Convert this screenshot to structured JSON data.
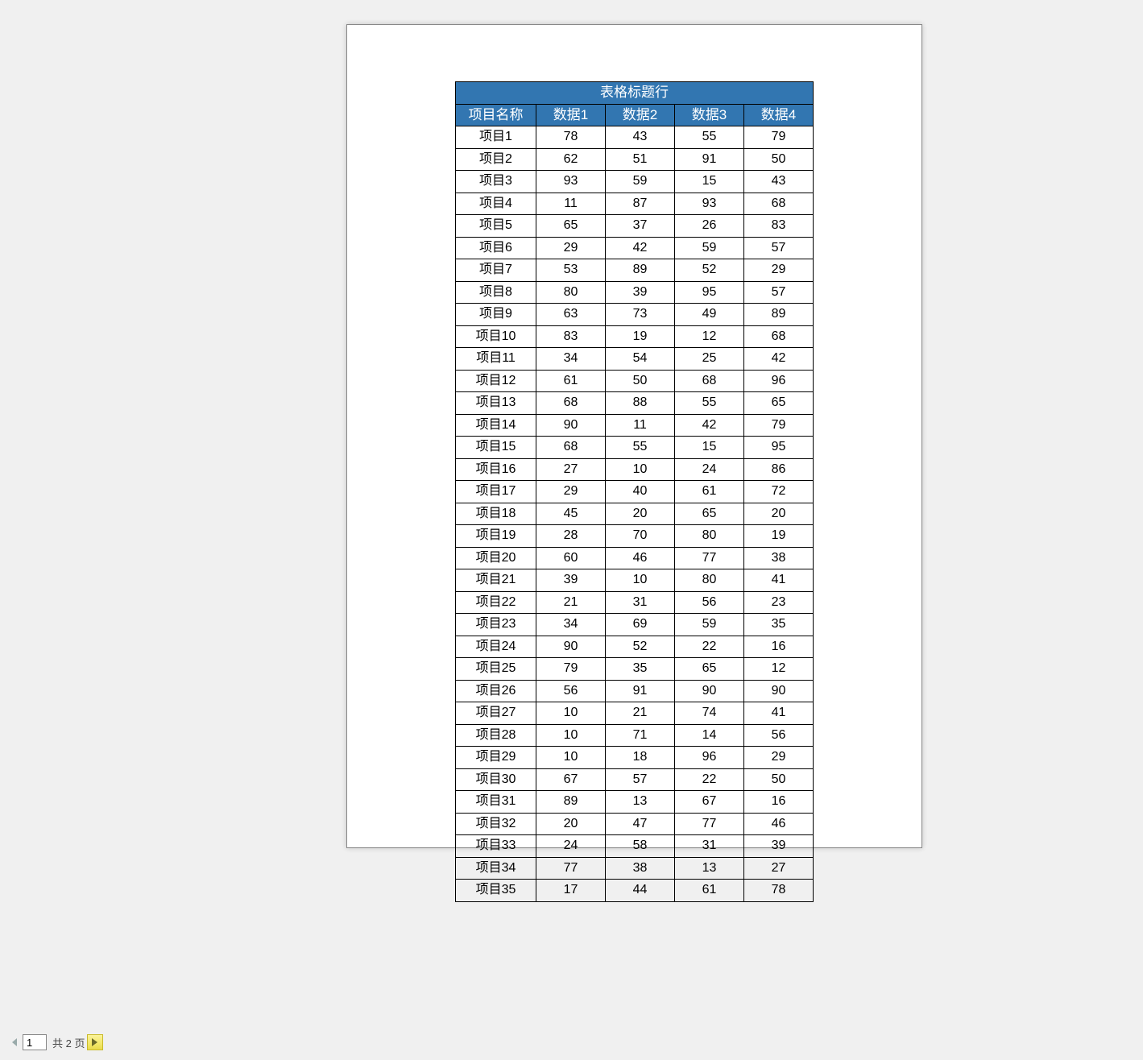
{
  "table": {
    "title": "表格标题行",
    "headers": [
      "项目名称",
      "数据1",
      "数据2",
      "数据3",
      "数据4"
    ],
    "rows": [
      {
        "name": "项目1",
        "d1": 78,
        "d2": 43,
        "d3": 55,
        "d4": 79
      },
      {
        "name": "项目2",
        "d1": 62,
        "d2": 51,
        "d3": 91,
        "d4": 50
      },
      {
        "name": "项目3",
        "d1": 93,
        "d2": 59,
        "d3": 15,
        "d4": 43
      },
      {
        "name": "项目4",
        "d1": 11,
        "d2": 87,
        "d3": 93,
        "d4": 68
      },
      {
        "name": "项目5",
        "d1": 65,
        "d2": 37,
        "d3": 26,
        "d4": 83
      },
      {
        "name": "项目6",
        "d1": 29,
        "d2": 42,
        "d3": 59,
        "d4": 57
      },
      {
        "name": "项目7",
        "d1": 53,
        "d2": 89,
        "d3": 52,
        "d4": 29
      },
      {
        "name": "项目8",
        "d1": 80,
        "d2": 39,
        "d3": 95,
        "d4": 57
      },
      {
        "name": "项目9",
        "d1": 63,
        "d2": 73,
        "d3": 49,
        "d4": 89
      },
      {
        "name": "项目10",
        "d1": 83,
        "d2": 19,
        "d3": 12,
        "d4": 68
      },
      {
        "name": "项目11",
        "d1": 34,
        "d2": 54,
        "d3": 25,
        "d4": 42
      },
      {
        "name": "项目12",
        "d1": 61,
        "d2": 50,
        "d3": 68,
        "d4": 96
      },
      {
        "name": "项目13",
        "d1": 68,
        "d2": 88,
        "d3": 55,
        "d4": 65
      },
      {
        "name": "项目14",
        "d1": 90,
        "d2": 11,
        "d3": 42,
        "d4": 79
      },
      {
        "name": "项目15",
        "d1": 68,
        "d2": 55,
        "d3": 15,
        "d4": 95
      },
      {
        "name": "项目16",
        "d1": 27,
        "d2": 10,
        "d3": 24,
        "d4": 86
      },
      {
        "name": "项目17",
        "d1": 29,
        "d2": 40,
        "d3": 61,
        "d4": 72
      },
      {
        "name": "项目18",
        "d1": 45,
        "d2": 20,
        "d3": 65,
        "d4": 20
      },
      {
        "name": "项目19",
        "d1": 28,
        "d2": 70,
        "d3": 80,
        "d4": 19
      },
      {
        "name": "项目20",
        "d1": 60,
        "d2": 46,
        "d3": 77,
        "d4": 38
      },
      {
        "name": "项目21",
        "d1": 39,
        "d2": 10,
        "d3": 80,
        "d4": 41
      },
      {
        "name": "项目22",
        "d1": 21,
        "d2": 31,
        "d3": 56,
        "d4": 23
      },
      {
        "name": "项目23",
        "d1": 34,
        "d2": 69,
        "d3": 59,
        "d4": 35
      },
      {
        "name": "项目24",
        "d1": 90,
        "d2": 52,
        "d3": 22,
        "d4": 16
      },
      {
        "name": "项目25",
        "d1": 79,
        "d2": 35,
        "d3": 65,
        "d4": 12
      },
      {
        "name": "项目26",
        "d1": 56,
        "d2": 91,
        "d3": 90,
        "d4": 90
      },
      {
        "name": "项目27",
        "d1": 10,
        "d2": 21,
        "d3": 74,
        "d4": 41
      },
      {
        "name": "项目28",
        "d1": 10,
        "d2": 71,
        "d3": 14,
        "d4": 56
      },
      {
        "name": "项目29",
        "d1": 10,
        "d2": 18,
        "d3": 96,
        "d4": 29
      },
      {
        "name": "项目30",
        "d1": 67,
        "d2": 57,
        "d3": 22,
        "d4": 50
      },
      {
        "name": "项目31",
        "d1": 89,
        "d2": 13,
        "d3": 67,
        "d4": 16
      },
      {
        "name": "项目32",
        "d1": 20,
        "d2": 47,
        "d3": 77,
        "d4": 46
      },
      {
        "name": "项目33",
        "d1": 24,
        "d2": 58,
        "d3": 31,
        "d4": 39
      },
      {
        "name": "项目34",
        "d1": 77,
        "d2": 38,
        "d3": 13,
        "d4": 27
      },
      {
        "name": "项目35",
        "d1": 17,
        "d2": 44,
        "d3": 61,
        "d4": 78
      }
    ]
  },
  "chart_data": {
    "type": "table",
    "title": "表格标题行",
    "columns": [
      "项目名称",
      "数据1",
      "数据2",
      "数据3",
      "数据4"
    ],
    "rows": [
      [
        "项目1",
        78,
        43,
        55,
        79
      ],
      [
        "项目2",
        62,
        51,
        91,
        50
      ],
      [
        "项目3",
        93,
        59,
        15,
        43
      ],
      [
        "项目4",
        11,
        87,
        93,
        68
      ],
      [
        "项目5",
        65,
        37,
        26,
        83
      ],
      [
        "项目6",
        29,
        42,
        59,
        57
      ],
      [
        "项目7",
        53,
        89,
        52,
        29
      ],
      [
        "项目8",
        80,
        39,
        95,
        57
      ],
      [
        "项目9",
        63,
        73,
        49,
        89
      ],
      [
        "项目10",
        83,
        19,
        12,
        68
      ],
      [
        "项目11",
        34,
        54,
        25,
        42
      ],
      [
        "项目12",
        61,
        50,
        68,
        96
      ],
      [
        "项目13",
        68,
        88,
        55,
        65
      ],
      [
        "项目14",
        90,
        11,
        42,
        79
      ],
      [
        "项目15",
        68,
        55,
        15,
        95
      ],
      [
        "项目16",
        27,
        10,
        24,
        86
      ],
      [
        "项目17",
        29,
        40,
        61,
        72
      ],
      [
        "项目18",
        45,
        20,
        65,
        20
      ],
      [
        "项目19",
        28,
        70,
        80,
        19
      ],
      [
        "项目20",
        60,
        46,
        77,
        38
      ],
      [
        "项目21",
        39,
        10,
        80,
        41
      ],
      [
        "项目22",
        21,
        31,
        56,
        23
      ],
      [
        "项目23",
        34,
        69,
        59,
        35
      ],
      [
        "项目24",
        90,
        52,
        22,
        16
      ],
      [
        "项目25",
        79,
        35,
        65,
        12
      ],
      [
        "项目26",
        56,
        91,
        90,
        90
      ],
      [
        "项目27",
        10,
        21,
        74,
        41
      ],
      [
        "项目28",
        10,
        71,
        14,
        56
      ],
      [
        "项目29",
        10,
        18,
        96,
        29
      ],
      [
        "项目30",
        67,
        57,
        22,
        50
      ],
      [
        "项目31",
        89,
        13,
        67,
        16
      ],
      [
        "项目32",
        20,
        47,
        77,
        46
      ],
      [
        "项目33",
        24,
        58,
        31,
        39
      ],
      [
        "项目34",
        77,
        38,
        13,
        27
      ],
      [
        "项目35",
        17,
        44,
        61,
        78
      ]
    ]
  },
  "pager": {
    "current": "1",
    "total_text": "共 2 页"
  }
}
